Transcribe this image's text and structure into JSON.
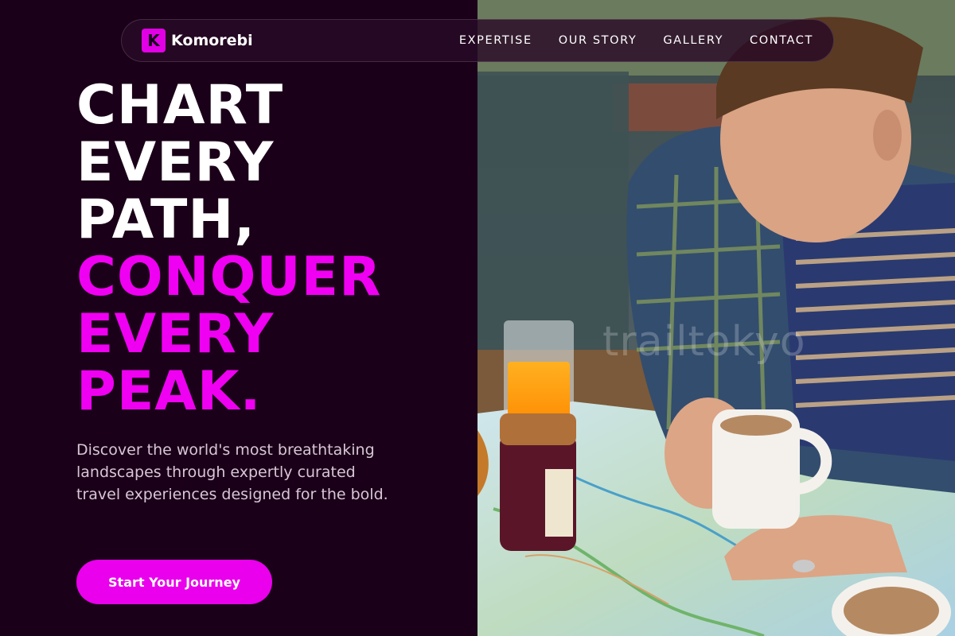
{
  "brand": {
    "logo_letter": "K",
    "name": "Komorebi"
  },
  "nav": {
    "links": [
      {
        "label": "EXPERTISE"
      },
      {
        "label": "OUR STORY"
      },
      {
        "label": "GALLERY"
      },
      {
        "label": "CONTACT"
      }
    ]
  },
  "hero": {
    "headline_lines": [
      "CHART",
      "EVERY",
      "PATH,"
    ],
    "accent_lines": [
      "CONQUER",
      "EVERY",
      "PEAK."
    ],
    "subtext": "Discover the world's most breathtaking landscapes through expertly curated travel experiences designed for the bold.",
    "cta_label": "Start Your Journey"
  },
  "photo": {
    "watermark": "trailtokyo",
    "description_icon": "man-reading-map-photo"
  },
  "colors": {
    "background": "#1a0018",
    "accent": "#ea00ec",
    "text_light": "#ffffff",
    "text_muted": "#d8c6d8"
  }
}
